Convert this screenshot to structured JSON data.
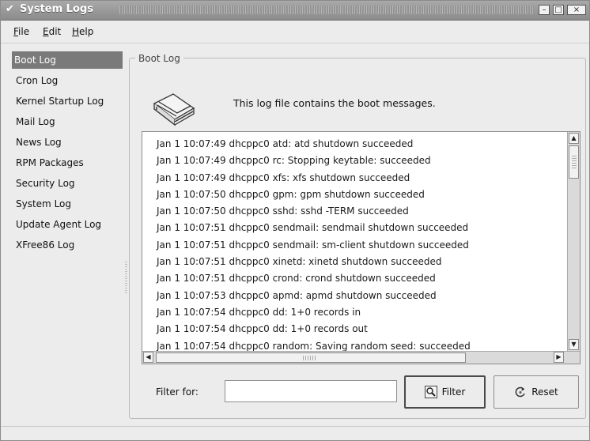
{
  "window": {
    "title": "System Logs",
    "controls": {
      "minimize": "–",
      "maximize": "□",
      "close": "×"
    }
  },
  "menu": [
    {
      "label": "File",
      "mnemonic": "F"
    },
    {
      "label": "Edit",
      "mnemonic": "E"
    },
    {
      "label": "Help",
      "mnemonic": "H"
    }
  ],
  "sidebar": {
    "items": [
      {
        "label": "Boot Log",
        "active": true
      },
      {
        "label": "Cron Log"
      },
      {
        "label": "Kernel Startup Log"
      },
      {
        "label": "Mail Log"
      },
      {
        "label": "News Log"
      },
      {
        "label": "RPM Packages"
      },
      {
        "label": "Security Log"
      },
      {
        "label": "System Log"
      },
      {
        "label": "Update Agent Log"
      },
      {
        "label": "XFree86 Log"
      }
    ]
  },
  "main": {
    "frame_title": "Boot Log",
    "icon": "book-icon",
    "description": "This log file contains the boot messages.",
    "log_lines": [
      "Jan  1 10:07:49 dhcppc0 atd: atd shutdown succeeded",
      "Jan  1 10:07:49 dhcppc0 rc: Stopping keytable:  succeeded",
      "Jan  1 10:07:49 dhcppc0 xfs: xfs shutdown succeeded",
      "Jan  1 10:07:50 dhcppc0 gpm: gpm shutdown succeeded",
      "Jan  1 10:07:50 dhcppc0 sshd: sshd -TERM succeeded",
      "Jan  1 10:07:51 dhcppc0 sendmail: sendmail shutdown succeeded",
      "Jan  1 10:07:51 dhcppc0 sendmail: sm-client shutdown succeeded",
      "Jan  1 10:07:51 dhcppc0 xinetd: xinetd shutdown succeeded",
      "Jan  1 10:07:51 dhcppc0 crond: crond shutdown succeeded",
      "Jan  1 10:07:53 dhcppc0 apmd: apmd shutdown succeeded",
      "Jan  1 10:07:54 dhcppc0 dd: 1+0 records in",
      "Jan  1 10:07:54 dhcppc0 dd: 1+0 records out",
      "Jan  1 10:07:54 dhcppc0 random: Saving random seed:  succeeded"
    ]
  },
  "filter": {
    "label": "Filter for:",
    "value": "",
    "filter_button": "Filter",
    "filter_icon": "magnifier-icon",
    "reset_button": "Reset",
    "reset_icon": "reset-icon"
  }
}
